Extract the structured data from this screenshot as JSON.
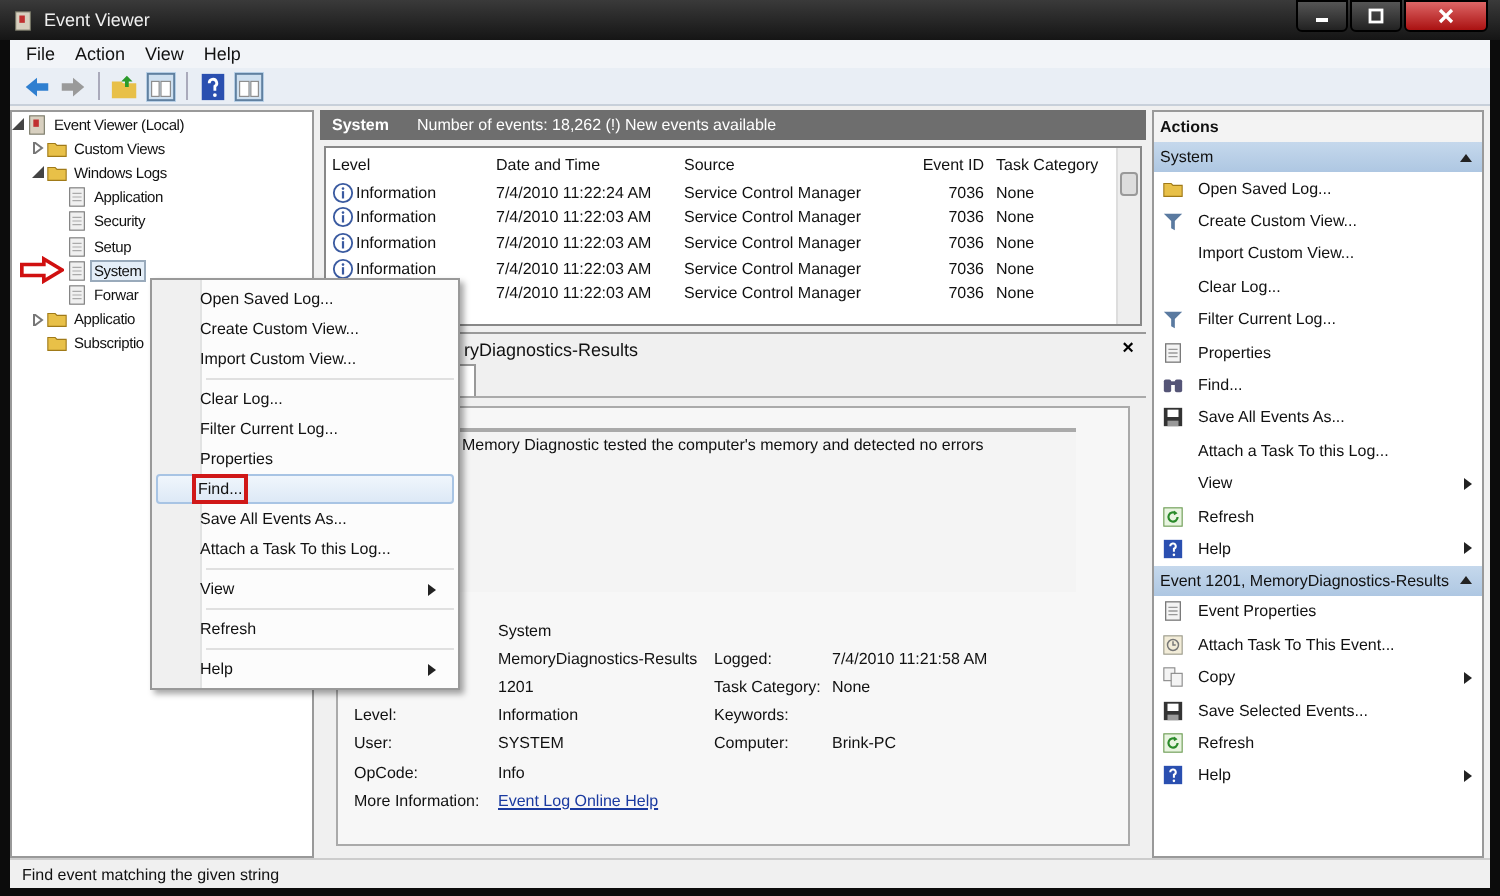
{
  "window": {
    "title": "Event Viewer"
  },
  "menu_bar": [
    "File",
    "Action",
    "View",
    "Help"
  ],
  "tree": [
    {
      "label": "Event Viewer (Local)",
      "selected": false,
      "expanded": true,
      "children": [
        {
          "label": "Custom Views",
          "selected": false,
          "expanded": false
        },
        {
          "label": "Windows Logs",
          "selected": false,
          "expanded": true,
          "children": [
            {
              "label": "Application",
              "selected": false
            },
            {
              "label": "Security",
              "selected": false
            },
            {
              "label": "Setup",
              "selected": false
            },
            {
              "label": "System",
              "selected": true,
              "marked": true
            },
            {
              "label": "Forwar",
              "selected": false
            }
          ]
        },
        {
          "label": "Applicatio",
          "selected": false,
          "expanded": false
        },
        {
          "label": "Subscriptio",
          "selected": false
        }
      ]
    }
  ],
  "log_header": {
    "title": "System",
    "summary": "Number of events: 18,262 (!) New events available"
  },
  "table": {
    "columns": [
      "Level",
      "Date and Time",
      "Source",
      "Event ID",
      "Task Category"
    ],
    "rows": [
      [
        "Information",
        "7/4/2010 11:22:24 AM",
        "Service Control Manager",
        "7036",
        "None"
      ],
      [
        "Information",
        "7/4/2010 11:22:03 AM",
        "Service Control Manager",
        "7036",
        "None"
      ],
      [
        "Information",
        "7/4/2010 11:22:03 AM",
        "Service Control Manager",
        "7036",
        "None"
      ],
      [
        "Information",
        "7/4/2010 11:22:03 AM",
        "Service Control Manager",
        "7036",
        "None"
      ],
      [
        null,
        "7/4/2010 11:22:03 AM",
        "Service Control Manager",
        "7036",
        "None"
      ]
    ]
  },
  "detail": {
    "title": "ryDiagnostics-Results",
    "close": "×",
    "message": "Memory Diagnostic tested the computer's memory and detected no errors",
    "fields": [
      {
        "value": "System"
      },
      {
        "value": "MemoryDiagnostics-Results",
        "label_2": "Logged:",
        "value_2": "7/4/2010 11:21:58 AM"
      },
      {
        "value": "1201",
        "label_2": "Task Category:",
        "value_2": "None"
      },
      {
        "label": "Level:",
        "value": "Information",
        "label_2": "Keywords:"
      },
      {
        "label": "User:",
        "value": "SYSTEM",
        "label_2": "Computer:",
        "value_2": "Brink-PC"
      },
      {
        "label": "OpCode:",
        "value": "Info"
      },
      {
        "label": "More Information:",
        "link": "Event Log Online Help"
      }
    ]
  },
  "context_menu": [
    [
      {
        "label": "Open Saved Log...",
        "selected": false
      },
      {
        "label": "Create Custom View...",
        "selected": false
      },
      {
        "label": "Import Custom View...",
        "selected": false
      }
    ],
    [
      {
        "label": "Clear Log...",
        "selected": false
      },
      {
        "label": "Filter Current Log...",
        "selected": false
      },
      {
        "label": "Properties",
        "selected": false
      },
      {
        "label": "Find...",
        "selected": true,
        "marked": true
      },
      {
        "label": "Save All Events As...",
        "selected": false
      },
      {
        "label": "Attach a Task To this Log...",
        "selected": false
      }
    ],
    [
      {
        "label": "View",
        "selected": false,
        "submenu": true
      }
    ],
    [
      {
        "label": "Refresh",
        "selected": false
      }
    ],
    [
      {
        "label": "Help",
        "selected": false,
        "submenu": true
      }
    ]
  ],
  "actions": {
    "title": "Actions",
    "sections": [
      {
        "title": "System",
        "expanded": true,
        "items": [
          {
            "label": "Open Saved Log..."
          },
          {
            "label": "Create Custom View..."
          },
          {
            "label": "Import Custom View..."
          },
          {
            "label": "Clear Log..."
          },
          {
            "label": "Filter Current Log..."
          },
          {
            "label": "Properties"
          },
          {
            "label": "Find..."
          },
          {
            "label": "Save All Events As..."
          },
          {
            "label": "Attach a Task To this Log..."
          },
          {
            "label": "View",
            "submenu": true
          },
          {
            "label": "Refresh"
          },
          {
            "label": "Help",
            "submenu": true
          }
        ]
      },
      {
        "title": "Event 1201, MemoryDiagnostics-Results",
        "expanded": true,
        "items": [
          {
            "label": "Event Properties"
          },
          {
            "label": "Attach Task To This Event..."
          },
          {
            "label": "Copy",
            "submenu": true
          },
          {
            "label": "Save Selected Events..."
          },
          {
            "label": "Refresh"
          },
          {
            "label": "Help",
            "submenu": true
          }
        ]
      }
    ]
  },
  "status_bar": "Find event matching the given string"
}
